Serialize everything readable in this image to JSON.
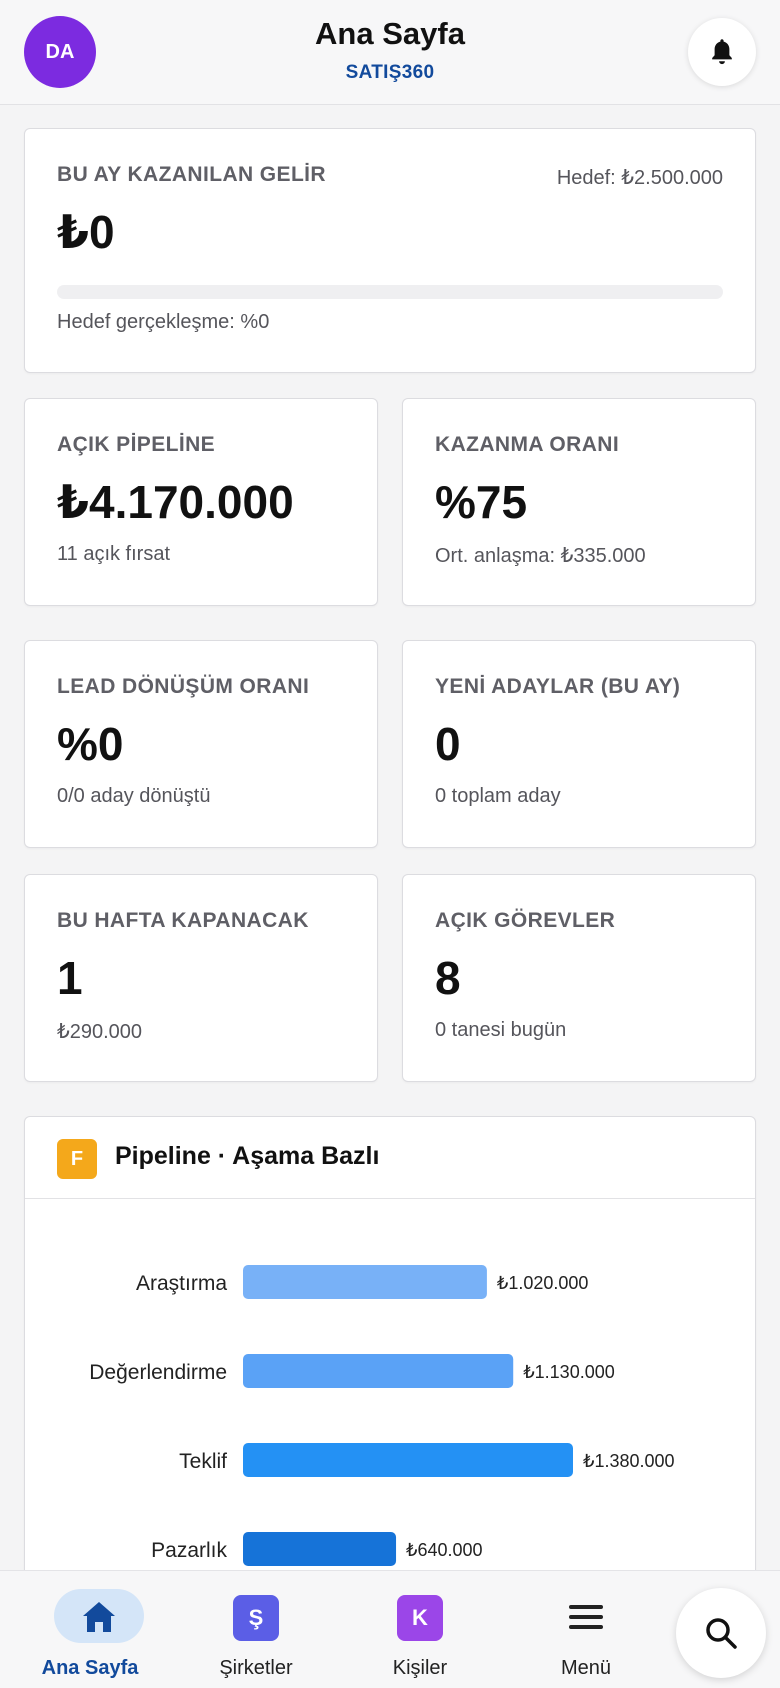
{
  "header": {
    "avatar_initials": "DA",
    "title": "Ana Sayfa",
    "brand": "SATIŞ360"
  },
  "revenue_card": {
    "label": "BU AY KAZANILAN GELİR",
    "target": "Hedef: ₺2.500.000",
    "value": "₺0",
    "progress_fraction": 0,
    "progress_text": "Hedef gerçekleşme: %0"
  },
  "metrics": [
    {
      "label": "AÇIK PİPELİNE",
      "value": "₺4.170.000",
      "sub": "11 açık fırsat"
    },
    {
      "label": "KAZANMA ORANI",
      "value": "%75",
      "sub": "Ort. anlaşma: ₺335.000"
    },
    {
      "label": "LEAD DÖNÜŞÜM ORANI",
      "value": "%0",
      "sub": "0/0 aday dönüştü"
    },
    {
      "label": "YENİ ADAYLAR (BU AY)",
      "value": "0",
      "sub": "0 toplam aday"
    },
    {
      "label": "BU HAFTA KAPANACAK",
      "value": "1",
      "sub": "₺290.000"
    },
    {
      "label": "AÇIK GÖREVLER",
      "value": "8",
      "sub": "0 tanesi bugün"
    }
  ],
  "pipeline": {
    "badge": "F",
    "title": "Pipeline · Aşama Bazlı"
  },
  "chart_data": {
    "type": "bar",
    "orientation": "horizontal",
    "categories": [
      "Araştırma",
      "Değerlendirme",
      "Teklif",
      "Pazarlık"
    ],
    "values": [
      1020000,
      1130000,
      1380000,
      640000
    ],
    "data_labels": [
      "₺1.020.000",
      "₺1.130.000",
      "₺1.380.000",
      "₺640.000"
    ],
    "colors": [
      "#78b1f7",
      "#5aa2f6",
      "#2491f4",
      "#1673d8"
    ],
    "grid": false,
    "legend": "none"
  },
  "bottom_nav": {
    "items": [
      {
        "label": "Ana Sayfa",
        "icon": "home-icon"
      },
      {
        "label": "Şirketler",
        "icon": "Ş"
      },
      {
        "label": "Kişiler",
        "icon": "K"
      },
      {
        "label": "Menü",
        "icon": "menu-icon"
      }
    ]
  },
  "colors": {
    "accent": "#124a9c",
    "avatar": "#7c2be0",
    "badge": "#f4a81b",
    "companies": "#5b5ee6",
    "people": "#9b46e8"
  }
}
